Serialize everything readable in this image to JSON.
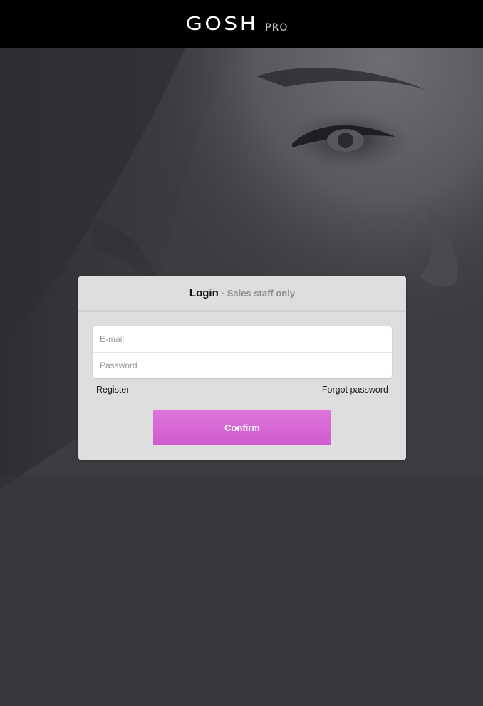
{
  "header": {
    "logo_text": "GOSH",
    "logo_suffix": "PRO"
  },
  "login": {
    "title": "Login",
    "subtitle": "· Sales staff only",
    "email_placeholder": "E-mail",
    "password_placeholder": "Password",
    "register_label": "Register",
    "forgot_label": "Forgot password",
    "confirm_label": "Confirm"
  },
  "colors": {
    "header_bg": "#000000",
    "panel_bg": "#dededf",
    "accent": "#d964d7"
  }
}
